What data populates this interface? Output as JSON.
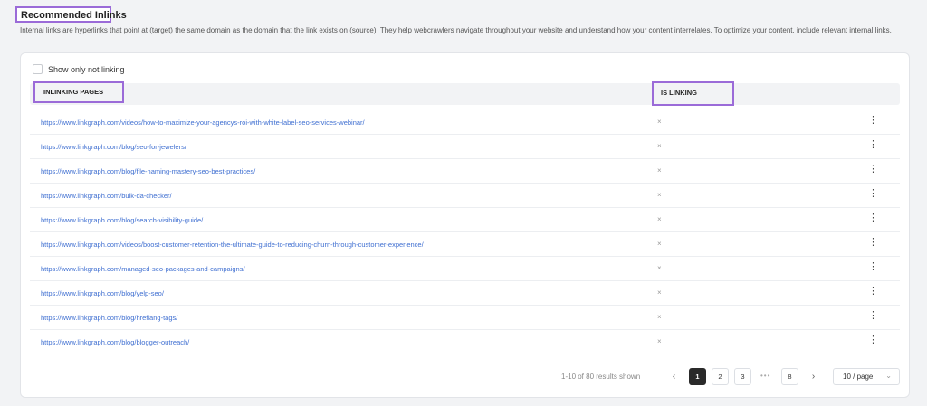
{
  "section": {
    "title": "Recommended Inlinks",
    "description": "Internal links are hyperlinks that point at (target) the same domain as the domain that the link exists on (source). They help webcrawlers navigate throughout your website and understand how your content interrelates. To optimize your content, include relevant internal links."
  },
  "filter": {
    "label": "Show only not linking",
    "checked": false
  },
  "table": {
    "headers": {
      "pages": "INLINKING PAGES",
      "linking": "IS LINKING"
    },
    "rows": [
      {
        "url": "https://www.linkgraph.com/videos/how-to-maximize-your-agencys-roi-with-white-label-seo-services-webinar/",
        "linking": "×",
        "menu": "⋮"
      },
      {
        "url": "https://www.linkgraph.com/blog/seo-for-jewelers/",
        "linking": "×",
        "menu": "⋮"
      },
      {
        "url": "https://www.linkgraph.com/blog/file-naming-mastery-seo-best-practices/",
        "linking": "×",
        "menu": "⋮"
      },
      {
        "url": "https://www.linkgraph.com/bulk-da-checker/",
        "linking": "×",
        "menu": "⋮"
      },
      {
        "url": "https://www.linkgraph.com/blog/search-visibility-guide/",
        "linking": "×",
        "menu": "⋮"
      },
      {
        "url": "https://www.linkgraph.com/videos/boost-customer-retention-the-ultimate-guide-to-reducing-churn-through-customer-experience/",
        "linking": "×",
        "menu": "⋮"
      },
      {
        "url": "https://www.linkgraph.com/managed-seo-packages-and-campaigns/",
        "linking": "×",
        "menu": "⋮"
      },
      {
        "url": "https://www.linkgraph.com/blog/yelp-seo/",
        "linking": "×",
        "menu": "⋮"
      },
      {
        "url": "https://www.linkgraph.com/blog/hreflang-tags/",
        "linking": "×",
        "menu": "⋮"
      },
      {
        "url": "https://www.linkgraph.com/blog/blogger-outreach/",
        "linking": "×",
        "menu": "⋮"
      }
    ]
  },
  "pagination": {
    "info": "1-10 of 80 results shown",
    "prev": "‹",
    "next": "›",
    "pages": [
      "1",
      "2",
      "3",
      "8"
    ],
    "ellipsis": "•••",
    "current": "1",
    "page_size": "10 / page",
    "page_size_chevron": "⌄"
  },
  "colors": {
    "highlight_border": "#9b6bd8",
    "link": "#3f6fd1",
    "active_page": "#2a2a2a"
  }
}
